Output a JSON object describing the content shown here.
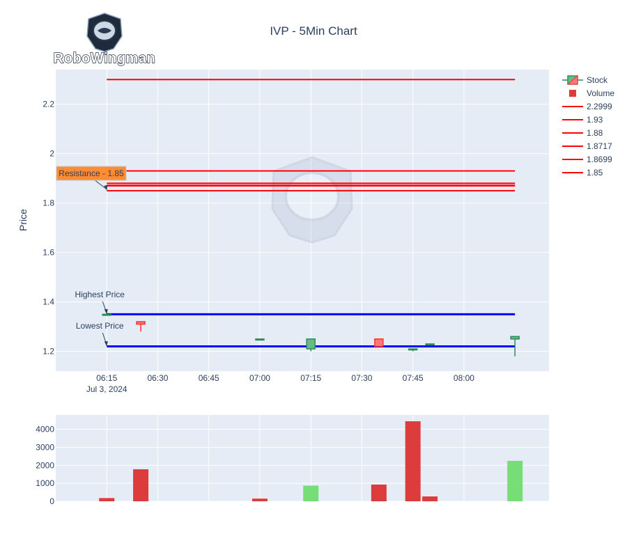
{
  "logo": {
    "text": "RoboWingman"
  },
  "chart_data": {
    "title": "IVP - 5Min Chart",
    "type": "candlestick",
    "price_axis": {
      "title": "Price",
      "range": [
        1.12,
        2.34
      ],
      "ticks": [
        1.2,
        1.4,
        1.6,
        1.8,
        2.0,
        2.2
      ],
      "tick_labels": [
        "1.2",
        "1.4",
        "1.6",
        "1.8",
        "2",
        "2.2"
      ]
    },
    "time_axis": {
      "range": [
        "2024-07-03T06:00",
        "2024-07-03T08:25"
      ],
      "ticks": [
        "2024-07-03T06:15",
        "2024-07-03T06:30",
        "2024-07-03T06:45",
        "2024-07-03T07:00",
        "2024-07-03T07:15",
        "2024-07-03T07:30",
        "2024-07-03T07:45",
        "2024-07-03T08:00"
      ],
      "tick_labels": [
        "06:15",
        "06:30",
        "06:45",
        "07:00",
        "07:15",
        "07:30",
        "07:45",
        "08:00"
      ],
      "date_label": "Jul 3, 2024"
    },
    "volume_axis": {
      "range": [
        0,
        4800
      ],
      "ticks": [
        0,
        1000,
        2000,
        3000,
        4000
      ],
      "tick_labels": [
        "0",
        "1000",
        "2000",
        "3000",
        "4000"
      ]
    },
    "candles": [
      {
        "time": "06:15",
        "open": 1.35,
        "high": 1.35,
        "low": 1.35,
        "close": 1.35
      },
      {
        "time": "06:25",
        "open": 1.32,
        "high": 1.32,
        "low": 1.28,
        "close": 1.31
      },
      {
        "time": "07:00",
        "open": 1.25,
        "high": 1.25,
        "low": 1.25,
        "close": 1.25
      },
      {
        "time": "07:15",
        "open": 1.21,
        "high": 1.25,
        "low": 1.2,
        "close": 1.25
      },
      {
        "time": "07:35",
        "open": 1.25,
        "high": 1.25,
        "low": 1.22,
        "close": 1.22
      },
      {
        "time": "07:45",
        "open": 1.21,
        "high": 1.21,
        "low": 1.2,
        "close": 1.21
      },
      {
        "time": "07:50",
        "open": 1.23,
        "high": 1.23,
        "low": 1.23,
        "close": 1.23
      },
      {
        "time": "08:15",
        "open": 1.25,
        "high": 1.26,
        "low": 1.18,
        "close": 1.26
      }
    ],
    "volume": [
      {
        "time": "06:15",
        "value": 180,
        "direction": "down"
      },
      {
        "time": "06:25",
        "value": 1780,
        "direction": "down"
      },
      {
        "time": "07:00",
        "value": 150,
        "direction": "down"
      },
      {
        "time": "07:15",
        "value": 870,
        "direction": "up"
      },
      {
        "time": "07:35",
        "value": 930,
        "direction": "down"
      },
      {
        "time": "07:45",
        "value": 4450,
        "direction": "down"
      },
      {
        "time": "07:50",
        "value": 270,
        "direction": "down"
      },
      {
        "time": "08:15",
        "value": 2250,
        "direction": "up"
      }
    ],
    "horizontal_lines": [
      {
        "value": 2.2999,
        "label": "2.2999",
        "color": "#ff0000"
      },
      {
        "value": 1.93,
        "label": "1.93",
        "color": "#ff0000"
      },
      {
        "value": 1.88,
        "label": "1.88",
        "color": "#ff0000"
      },
      {
        "value": 1.8717,
        "label": "1.8717",
        "color": "#ff0000"
      },
      {
        "value": 1.8699,
        "label": "1.8699",
        "color": "#ff0000"
      },
      {
        "value": 1.85,
        "label": "1.85",
        "color": "#ff0000"
      }
    ],
    "highest_price": {
      "value": 1.35,
      "label": "Highest Price",
      "color": "#0000ff"
    },
    "lowest_price": {
      "value": 1.22,
      "label": "Lowest Price",
      "color": "#0000ff"
    },
    "resistance": {
      "value": 1.85,
      "label": "Resistance - 1.85",
      "color": "#ff8c33"
    },
    "legend": {
      "position": "right",
      "items": [
        "Stock",
        "Volume",
        "2.2999",
        "1.93",
        "1.88",
        "1.8717",
        "1.8699",
        "1.85"
      ]
    },
    "colors": {
      "increasing": "#2e8b57",
      "increasing_fill": "#66bb88",
      "decreasing": "#ff3030",
      "decreasing_fill": "#ff7777",
      "volume_up": "#77dd77",
      "volume_down": "#dd3c3c",
      "plot_bg": "#e5ecf6"
    }
  }
}
